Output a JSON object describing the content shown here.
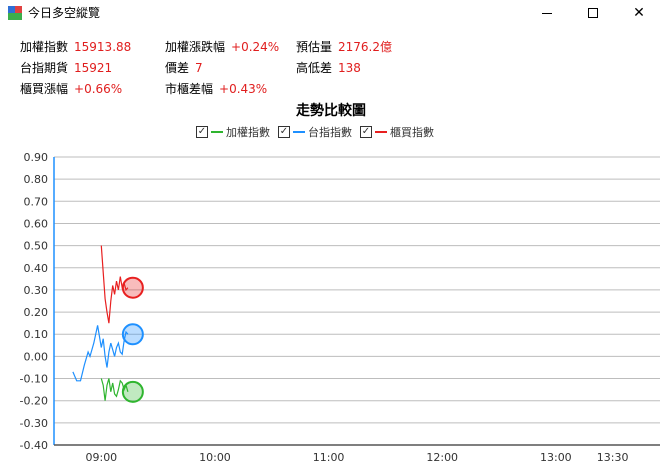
{
  "window": {
    "title": "今日多空縱覽",
    "min_glyph": "",
    "max_glyph": "",
    "close_glyph": "✕"
  },
  "stats": {
    "weighted_index": {
      "label": "加權指數",
      "value": "15913.88"
    },
    "weighted_change": {
      "label": "加權漲跌幅",
      "value": "+0.24%"
    },
    "estimated_volume": {
      "label": "預估量",
      "value": "2176.2億"
    },
    "tx_futures": {
      "label": "台指期貨",
      "value": "15921"
    },
    "spread": {
      "label": "價差",
      "value": "7"
    },
    "high_low_spread": {
      "label": "高低差",
      "value": "138"
    },
    "otc_change": {
      "label": "櫃買漲幅",
      "value": "+0.66%"
    },
    "market_otc_spread": {
      "label": "市櫃差幅",
      "value": "+0.43%"
    }
  },
  "legend": {
    "check_glyph": "✓",
    "colors": {
      "weighted": "#2fb52f",
      "taiex_futures": "#1e90ff",
      "otc": "#e82020"
    }
  },
  "chart_data": {
    "type": "line",
    "title": "走勢比較圖",
    "xlabel": "",
    "ylabel": "",
    "ylim": [
      -0.4,
      0.9
    ],
    "yticks": [
      "0.90",
      "0.80",
      "0.70",
      "0.60",
      "0.50",
      "0.40",
      "0.30",
      "0.20",
      "0.10",
      "0.00",
      "-0.10",
      "-0.20",
      "-0.30",
      "-0.40"
    ],
    "xtick_labels": [
      "09:00",
      "10:00",
      "11:00",
      "12:00",
      "13:00",
      "13:30"
    ],
    "xtick_minutes": [
      0,
      60,
      120,
      180,
      240,
      270
    ],
    "xlim_minutes": [
      -25,
      295
    ],
    "grid": true,
    "series": [
      {
        "name": "加權指數",
        "color": "#2fb52f",
        "x": [
          0,
          1,
          2,
          3,
          4,
          5,
          6,
          7,
          8,
          9,
          10,
          11,
          12,
          13,
          14
        ],
        "y": [
          -0.1,
          -0.13,
          -0.2,
          -0.13,
          -0.1,
          -0.16,
          -0.12,
          -0.17,
          -0.18,
          -0.15,
          -0.11,
          -0.12,
          -0.15,
          -0.13,
          -0.16
        ],
        "end_marker": -0.16
      },
      {
        "name": "台指指數",
        "color": "#1e90ff",
        "x": [
          -15,
          -13,
          -11,
          -9,
          -7,
          -6,
          -4,
          -2,
          0,
          1,
          2,
          3,
          4,
          5,
          6,
          7,
          8,
          9,
          10,
          11,
          12,
          13,
          14
        ],
        "y": [
          -0.07,
          -0.11,
          -0.11,
          -0.04,
          0.02,
          0.0,
          0.06,
          0.14,
          0.04,
          0.08,
          0.0,
          -0.05,
          0.02,
          0.06,
          0.03,
          0.0,
          0.04,
          0.06,
          0.02,
          0.01,
          0.07,
          0.11,
          0.1
        ],
        "end_marker": 0.1
      },
      {
        "name": "櫃買指數",
        "color": "#e82020",
        "x": [
          0,
          1,
          2,
          3,
          4,
          5,
          6,
          7,
          8,
          9,
          10,
          11,
          12,
          13,
          14
        ],
        "y": [
          0.5,
          0.38,
          0.26,
          0.2,
          0.15,
          0.25,
          0.32,
          0.28,
          0.34,
          0.3,
          0.36,
          0.31,
          0.33,
          0.3,
          0.31
        ],
        "end_marker": 0.31
      }
    ]
  }
}
